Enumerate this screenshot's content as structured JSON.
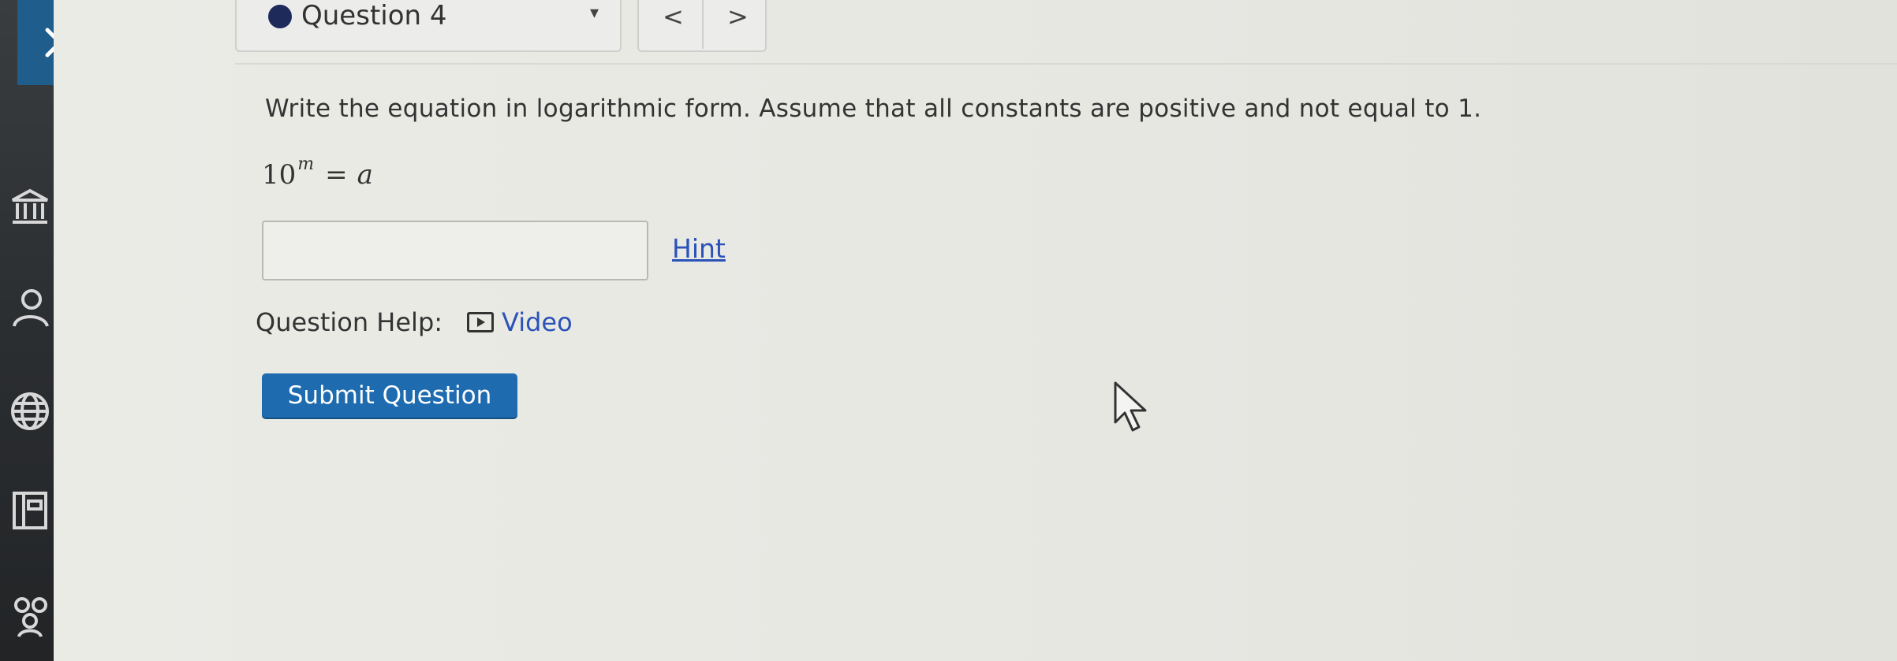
{
  "rail": {
    "close_label": "×",
    "icons": [
      "close-icon",
      "institution-icon",
      "user-icon",
      "globe-icon",
      "gradebook-icon",
      "people-icon"
    ]
  },
  "topbar": {
    "question_label": "Question 4",
    "caret": "▾",
    "prev": "<",
    "next": ">"
  },
  "content": {
    "prompt": "Write the equation in logarithmic form. Assume that all constants are positive and not equal to 1.",
    "equation": {
      "base": "10",
      "exponent": "m",
      "equals": "=",
      "rhs": "a"
    },
    "answer_value": "",
    "hint_label": "Hint",
    "help_label": "Question Help:",
    "video_label": "Video",
    "submit_label": "Submit Question"
  },
  "colors": {
    "accent": "#1e6bb0",
    "close_bg": "#1f5d8c",
    "link": "#2a52b8",
    "question_dot": "#1d2a5a"
  }
}
